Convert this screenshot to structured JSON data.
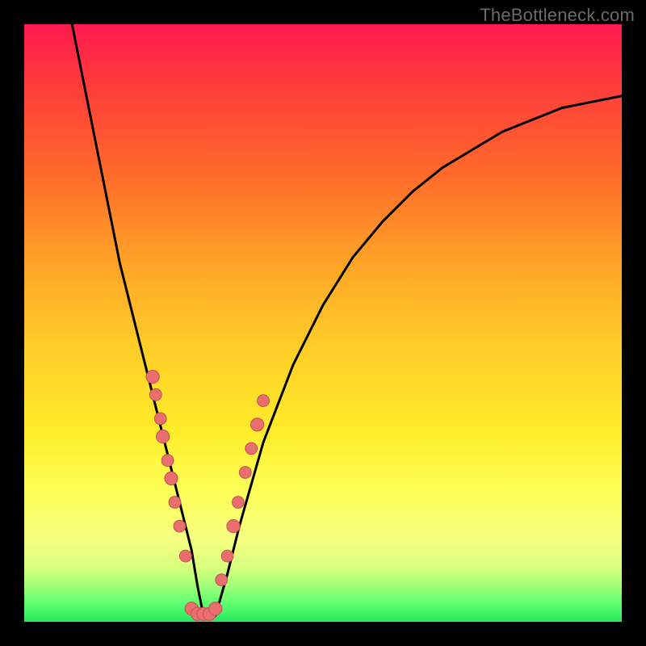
{
  "watermark": "TheBottleneck.com",
  "chart_data": {
    "type": "line",
    "title": "",
    "xlabel": "",
    "ylabel": "",
    "xlim": [
      0,
      100
    ],
    "ylim": [
      0,
      100
    ],
    "series": [
      {
        "name": "curve",
        "color": "#000000",
        "x": [
          8,
          10,
          12,
          14,
          16,
          18,
          20,
          22,
          24,
          26,
          28,
          29,
          30,
          31,
          32,
          34,
          36,
          40,
          45,
          50,
          55,
          60,
          65,
          70,
          75,
          80,
          85,
          90,
          95,
          100
        ],
        "y": [
          100,
          90,
          80,
          70,
          60,
          52,
          44,
          36,
          28,
          20,
          12,
          6,
          1,
          1,
          1,
          8,
          16,
          30,
          43,
          53,
          61,
          67,
          72,
          76,
          79,
          82,
          84,
          86,
          87,
          88
        ]
      }
    ],
    "markers": [
      {
        "x": 21.5,
        "y": 41,
        "r": 1.1
      },
      {
        "x": 22.0,
        "y": 38,
        "r": 1.0
      },
      {
        "x": 22.8,
        "y": 34,
        "r": 1.0
      },
      {
        "x": 23.2,
        "y": 31,
        "r": 1.1
      },
      {
        "x": 24.0,
        "y": 27,
        "r": 1.0
      },
      {
        "x": 24.6,
        "y": 24,
        "r": 1.1
      },
      {
        "x": 25.2,
        "y": 20,
        "r": 1.0
      },
      {
        "x": 26.0,
        "y": 16,
        "r": 1.0
      },
      {
        "x": 27.0,
        "y": 11,
        "r": 1.0
      },
      {
        "x": 28.0,
        "y": 2.2,
        "r": 1.1
      },
      {
        "x": 29.0,
        "y": 1.3,
        "r": 1.1
      },
      {
        "x": 30.0,
        "y": 1.3,
        "r": 1.1
      },
      {
        "x": 31.0,
        "y": 1.3,
        "r": 1.1
      },
      {
        "x": 32.0,
        "y": 2.2,
        "r": 1.1
      },
      {
        "x": 33.0,
        "y": 7,
        "r": 1.0
      },
      {
        "x": 34.0,
        "y": 11,
        "r": 1.0
      },
      {
        "x": 35.0,
        "y": 16,
        "r": 1.1
      },
      {
        "x": 35.8,
        "y": 20,
        "r": 1.0
      },
      {
        "x": 37.0,
        "y": 25,
        "r": 1.0
      },
      {
        "x": 38.0,
        "y": 29,
        "r": 1.0
      },
      {
        "x": 39.0,
        "y": 33,
        "r": 1.1
      },
      {
        "x": 40.0,
        "y": 37,
        "r": 1.0
      }
    ],
    "marker_style": {
      "fill": "#e96f6f",
      "stroke": "#c94f4f"
    }
  }
}
